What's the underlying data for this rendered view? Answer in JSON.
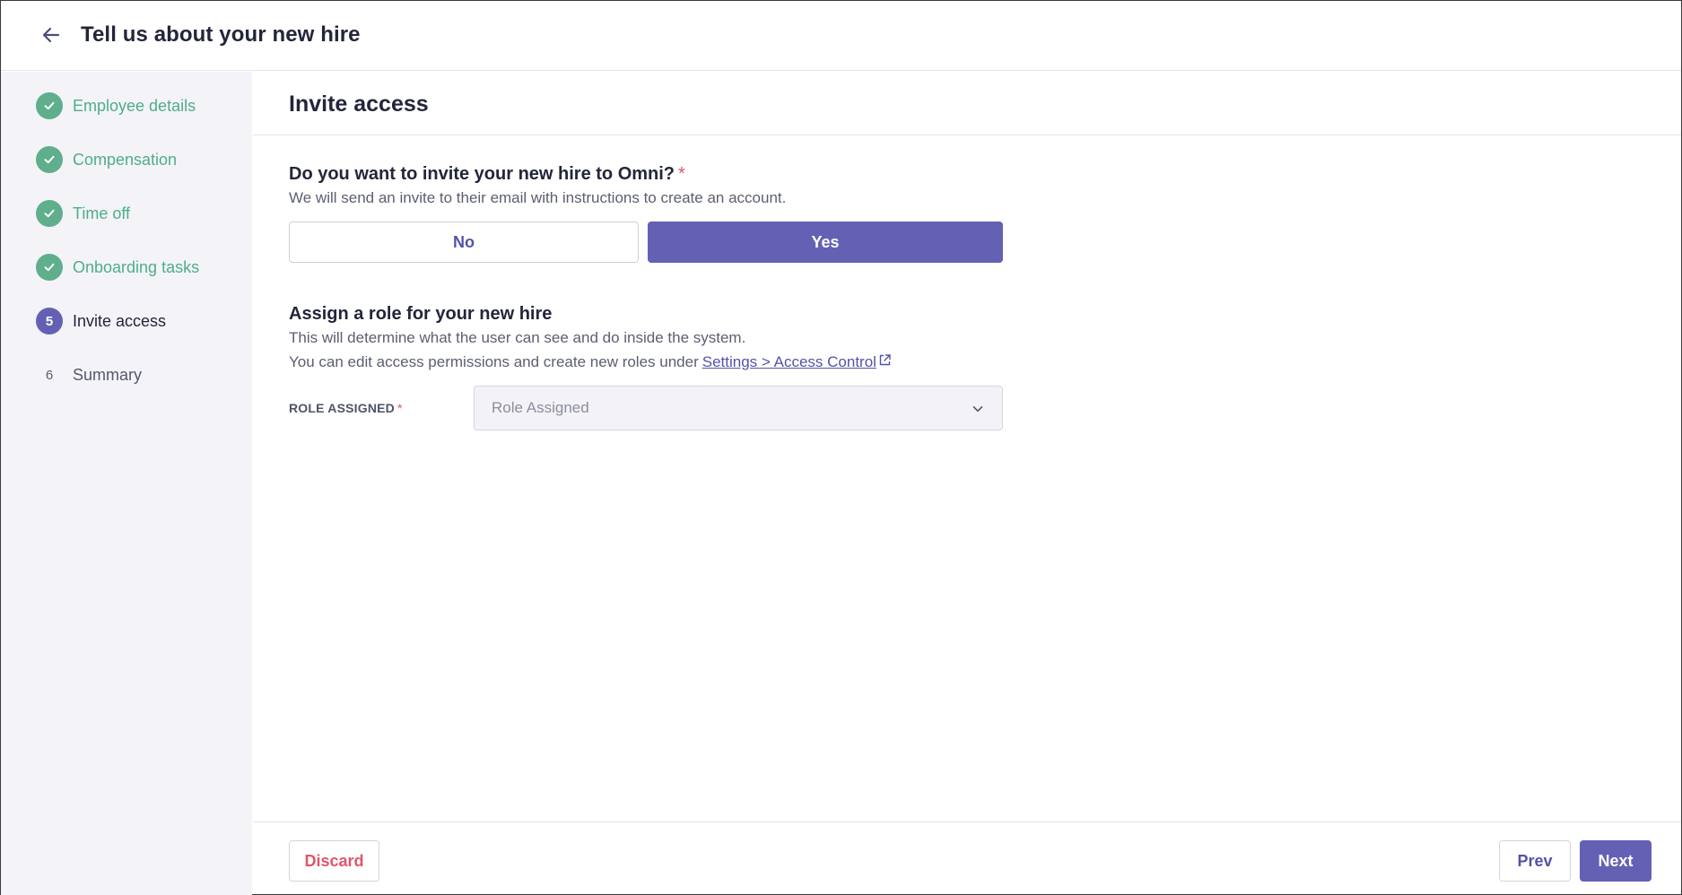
{
  "header": {
    "title": "Tell us about your new hire",
    "back_icon": "arrow-left-icon"
  },
  "colors": {
    "accent": "#6461b5",
    "done": "#5fae8c",
    "required": "#e0566b",
    "sidebar_bg": "#f3f3f8"
  },
  "sidebar": {
    "steps": [
      {
        "label": "Employee details",
        "state": "done",
        "marker": "check-icon"
      },
      {
        "label": "Compensation",
        "state": "done",
        "marker": "check-icon"
      },
      {
        "label": "Time off",
        "state": "done",
        "marker": "check-icon"
      },
      {
        "label": "Onboarding tasks",
        "state": "done",
        "marker": "check-icon"
      },
      {
        "label": "Invite access",
        "state": "active",
        "number": "5"
      },
      {
        "label": "Summary",
        "state": "pending",
        "number": "6"
      }
    ]
  },
  "main": {
    "title": "Invite access",
    "invite_question": "Do you want to invite your new hire to Omni?",
    "required_mark": "*",
    "invite_description": "We will send an invite to their email with instructions to create an account.",
    "options": {
      "no": "No",
      "yes": "Yes",
      "selected": "yes"
    },
    "role_question": "Assign a role for your new hire",
    "role_description_1": "This will determine what the user can see and do inside the system.",
    "role_description_2": "You can edit access permissions and create new roles under",
    "role_link": "Settings > Access Control",
    "role_field_label": "ROLE ASSIGNED",
    "role_placeholder": "Role Assigned"
  },
  "footer": {
    "discard": "Discard",
    "prev": "Prev",
    "next": "Next"
  }
}
